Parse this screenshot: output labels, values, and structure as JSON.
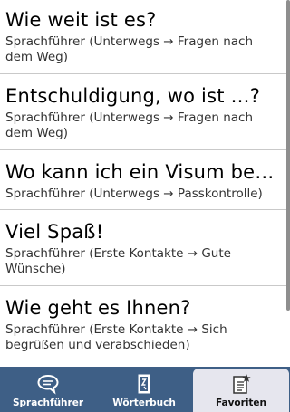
{
  "list": {
    "items": [
      {
        "title": "Wie weit ist es?",
        "subtitle": "Sprachführer (Unterwegs → Fragen nach dem Weg)"
      },
      {
        "title": "Entschuldigung, wo ist …?",
        "subtitle": "Sprachführer (Unterwegs → Fragen nach dem Weg)"
      },
      {
        "title": "Wo kann ich ein Visum be…",
        "subtitle": "Sprachführer (Unterwegs → Passkontrolle)"
      },
      {
        "title": "Viel Spaß!",
        "subtitle": "Sprachführer (Erste Kontakte → Gute Wünsche)"
      },
      {
        "title": "Wie geht es Ihnen?",
        "subtitle": "Sprachführer (Erste Kontakte → Sich begrüßen und verabschieden)"
      }
    ]
  },
  "tabs": {
    "phrasebook": {
      "label": "Sprachführer",
      "icon": "speech-bubble-icon"
    },
    "dictionary": {
      "label": "Wörterbuch",
      "icon": "dictionary-book-icon"
    },
    "favorites": {
      "label": "Favoriten",
      "icon": "favorites-star-document-icon",
      "active": true
    }
  },
  "colors": {
    "tabbar": "#3e5f86",
    "active_tab": "#e6e6ee",
    "divider": "#c9c9c9"
  }
}
